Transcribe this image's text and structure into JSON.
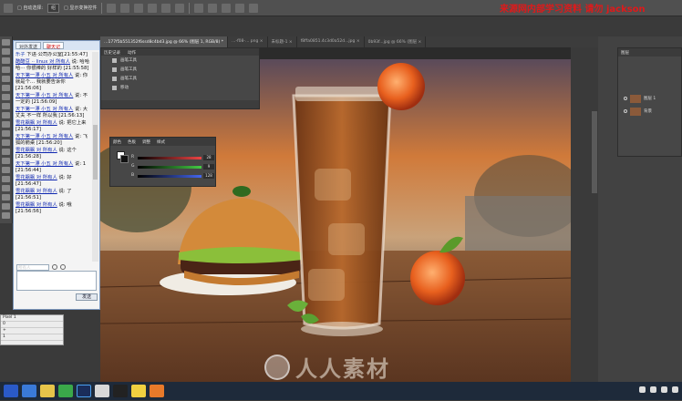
{
  "options_bar": {
    "items": [
      "Ps",
      "□ 自动选择:",
      "组",
      "□ 显示变换控件"
    ]
  },
  "watermark_top": "来源网内部学习资料 请勿 jackson",
  "document_tabs": [
    {
      "label": "…177f5b551352f6ssd8c4bd3.jpg @ 66% (图层 1, RGB/8) *",
      "active": true
    },
    {
      "label": "…-f08-... png ×",
      "active": false
    },
    {
      "label": "未标题-1 ×",
      "active": false
    },
    {
      "label": "f8ffa0851.4c3d0a52d...jpg ×",
      "active": false
    },
    {
      "label": "0b93f...jpg @ 66% (图层 ×",
      "active": false
    }
  ],
  "history_panel": {
    "tabs": [
      "历史记录",
      "动作"
    ],
    "rows": [
      "画笔工具",
      "画笔工具",
      "画笔工具",
      "移动"
    ]
  },
  "color_panel": {
    "tabs": [
      "颜色",
      "色板",
      "调整",
      "样式"
    ],
    "channels": [
      {
        "label": "R",
        "value": "28",
        "color": "#e44"
      },
      {
        "label": "G",
        "value": "9",
        "color": "#4c4"
      },
      {
        "label": "B",
        "value": "128",
        "color": "#46e"
      }
    ]
  },
  "chat_window": {
    "tabs": [
      {
        "label": "对外发送",
        "active": false
      },
      {
        "label": "聊天记",
        "active": true
      }
    ],
    "messages": [
      {
        "user": "乐子",
        "text": "下进·公司办公室[21:55:47]"
      },
      {
        "user": "酷酷豆 ·· linux 对 所有人",
        "text": "说: 哈哈哈··· 你很棒的 好样的 [21:55:58]"
      },
      {
        "user": "天下第一漂 小五 对 所有人",
        "text": "说: 你就是个… 我就要告诉你 [21:56:06]"
      },
      {
        "user": "天下第一漂 小五 对 所有人",
        "text": "说: 不一定的 [21:56:09]"
      },
      {
        "user": "天下第一漂 小五 对 所有人",
        "text": "说: 大丈夫 不一样 所以我 [21:56:13]"
      },
      {
        "user": "雪花飘飘 对 所有人",
        "text": "说: 把它上来 [21:56:17]"
      },
      {
        "user": "天下第一漂 小五 对 所有人",
        "text": "说: 飞狐的箭桌 [21:56:20]"
      },
      {
        "user": "雪花飘飘 对 所有人",
        "text": "说: 这个 [21:56:28]"
      },
      {
        "user": "天下第一漂 小五 对 所有人",
        "text": "说: 1 [21:56:44]"
      },
      {
        "user": "雪花飘飘 对 所有人",
        "text": "说: 好 [21:56:47]"
      },
      {
        "user": "雪花飘飘 对 所有人",
        "text": "说: 了 [21:56:51]"
      },
      {
        "user": "雪花飘飘 对 所有人",
        "text": "说: 哦 [21:56:56]"
      }
    ],
    "recipient": "所有人",
    "send_label": "发送"
  },
  "mini_window": {
    "rows": [
      "Pixel 1",
      "0",
      "+",
      "1"
    ]
  },
  "layers_panel": {
    "header": "图层",
    "layers": [
      {
        "label": "图层 1"
      },
      {
        "label": "背景"
      }
    ]
  },
  "artwork_watermark": "人人素材",
  "taskbar": {
    "icons": [
      "start-icon",
      "ie-icon",
      "explorer-icon",
      "chrome-icon",
      "photoshop-icon",
      "qq-icon",
      "recorder-icon",
      "app-icon",
      "files-icon"
    ]
  },
  "colors": {
    "ps_bg": "#3a3a3a",
    "panel": "#474747",
    "accent_red": "#e0191a"
  }
}
